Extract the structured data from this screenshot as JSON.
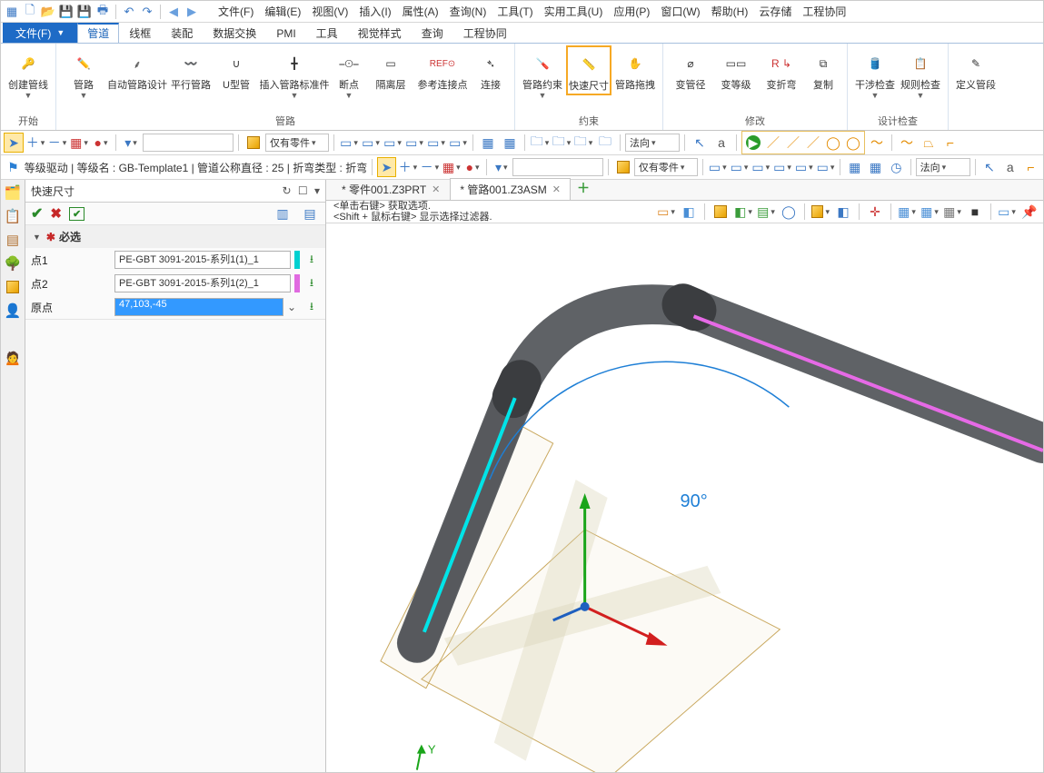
{
  "menu": {
    "file": "文件(F)",
    "edit": "编辑(E)",
    "view": "视图(V)",
    "insert": "插入(I)",
    "attr": "属性(A)",
    "query": "查询(N)",
    "tool": "工具(T)",
    "util": "实用工具(U)",
    "app": "应用(P)",
    "window": "窗口(W)",
    "help": "帮助(H)",
    "cloud": "云存储",
    "collab": "工程协同"
  },
  "ribbon_tabs": {
    "file": "文件(F)",
    "pipe": "管道",
    "wire": "线框",
    "assemble": "装配",
    "data": "数据交换",
    "pmi": "PMI",
    "tools": "工具",
    "style": "视觉样式",
    "query": "查询",
    "collab": "工程协同"
  },
  "groups": {
    "start": "开始",
    "route": "管路",
    "constraint": "约束",
    "modify": "修改",
    "design_check": "设计检查"
  },
  "btn": {
    "create_route": "创建管线",
    "route": "管路",
    "auto_design": "自动管路设计",
    "parallel": "平行管路",
    "utube": "U型管",
    "insert_std": "插入管路标准件",
    "break": "断点",
    "iso": "隔离层",
    "ref_conn": "参考连接点",
    "connect": "连接",
    "route_constraint": "管路约束",
    "quick_dim": "快速尺寸",
    "route_drag": "管路拖拽",
    "change_dia": "变管径",
    "change_grade": "变等级",
    "change_bend": "变折弯",
    "copy": "复制",
    "interfere": "干涉检查",
    "rule_check": "规则检查",
    "define_pipe": "定义管段"
  },
  "toolbar2": {
    "only_parts": "仅有零件",
    "normal": "法向"
  },
  "status_line": "等级驱动 | 等级名 : GB-Template1 | 管道公称直径 : 25 | 折弯类型 : 折弯",
  "panel": {
    "title": "快速尺寸",
    "section": "必选",
    "pt1_label": "点1",
    "pt1_value": "PE-GBT 3091-2015-系列1(1)_1",
    "pt2_label": "点2",
    "pt2_value": "PE-GBT 3091-2015-系列1(2)_1",
    "origin_label": "原点",
    "origin_value": "47,103,-45"
  },
  "docs": {
    "part": "* 零件001.Z3PRT",
    "asm": "* 管路001.Z3ASM"
  },
  "viewport": {
    "tip1": "<单击右键> 获取选项.",
    "tip2": "<Shift + 鼠标右键> 显示选择过滤器.",
    "angle": "90°",
    "axisY": "Y"
  },
  "vtb": {
    "only_parts": "仅有零件",
    "normal": "法向"
  }
}
